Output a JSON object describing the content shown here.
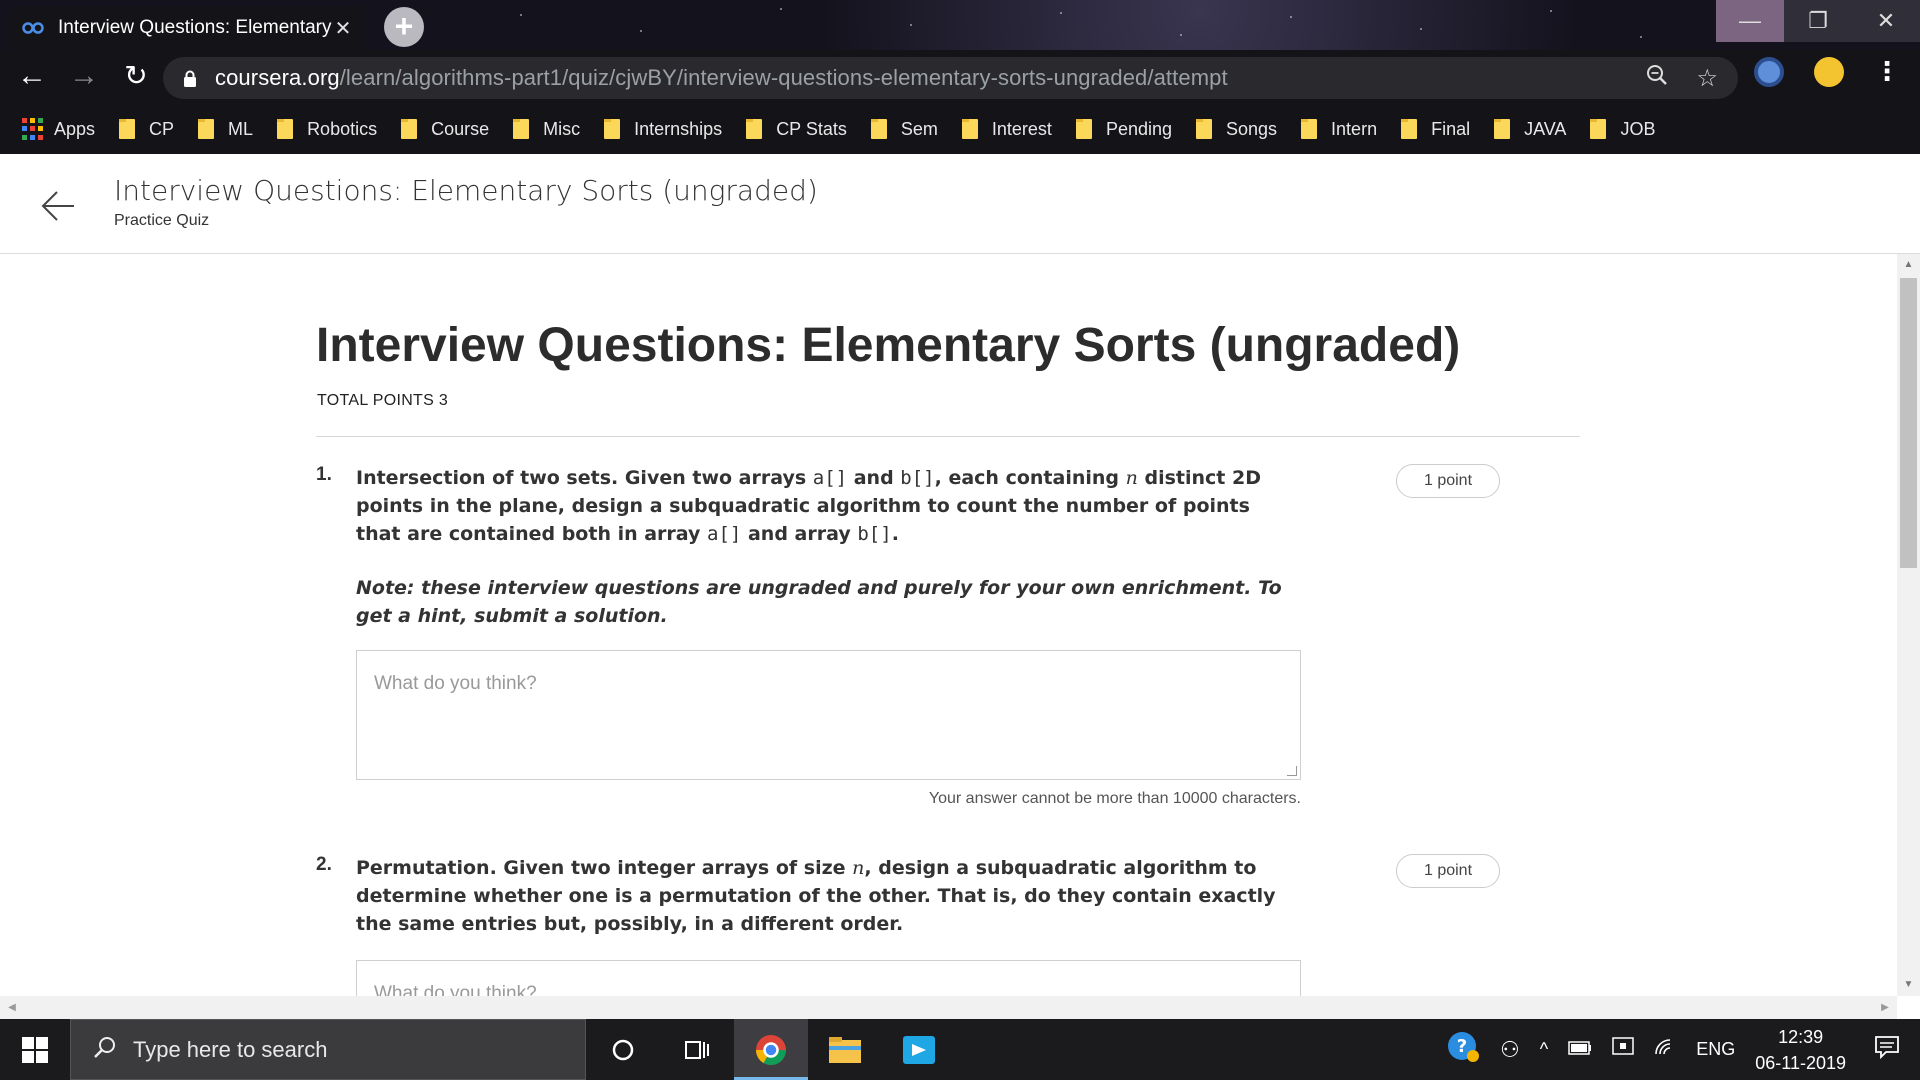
{
  "browser": {
    "tab_title": "Interview Questions: Elementary",
    "tab_close": "✕",
    "new_tab": "+",
    "url_host": "coursera.org",
    "url_path": "/learn/algorithms-part1/quiz/cjwBY/interview-questions-elementary-sorts-ungraded/attempt",
    "bookmarks": [
      "Apps",
      "CP",
      "ML",
      "Robotics",
      "Course",
      "Misc",
      "Internships",
      "CP Stats",
      "Sem",
      "Interest",
      "Pending",
      "Songs",
      "Intern",
      "Final",
      "JAVA",
      "JOB"
    ]
  },
  "header": {
    "title": "Interview Questions: Elementary Sorts (ungraded)",
    "subtitle": "Practice Quiz"
  },
  "quiz": {
    "title": "Interview Questions: Elementary Sorts (ungraded)",
    "total_points": "TOTAL POINTS 3",
    "questions": [
      {
        "number": "1.",
        "points": "1 point",
        "t1": "Intersection of two sets. Given two arrays ",
        "c1": "a[]",
        "t2": " and ",
        "c2": "b[]",
        "t3": ", each containing ",
        "n": "n",
        "t4": " distinct 2D points in the plane, design a subquadratic algorithm to count the number of points that are contained both in array ",
        "c3": "a[]",
        "t5": " and array ",
        "c4": "b[]",
        "t6": ".",
        "note": "Note: these interview questions are ungraded and purely for your own enrichment. To get a hint, submit a solution.",
        "placeholder": "What do you think?",
        "limit": "Your answer cannot be more than 10000 characters."
      },
      {
        "number": "2.",
        "points": "1 point",
        "t1": "Permutation. Given two integer arrays of size ",
        "n": "n",
        "t2": ", design a subquadratic algorithm to determine whether one is a permutation of the other. That is, do they contain exactly the same entries but, possibly, in a different order.",
        "placeholder": "What do you think?"
      }
    ]
  },
  "taskbar": {
    "search_placeholder": "Type here to search",
    "language": "ENG",
    "time": "12:39",
    "date": "06-11-2019"
  },
  "colors": {
    "folder": "#fbd85a",
    "taskbar": "#1b1b1d",
    "chrome": "#141318"
  }
}
